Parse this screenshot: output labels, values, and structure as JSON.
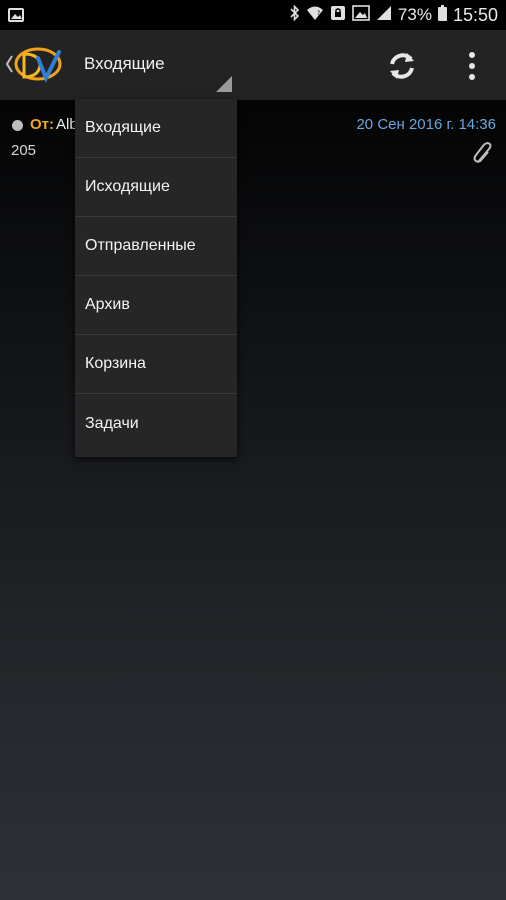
{
  "status_bar": {
    "battery_percent": "73%",
    "time": "15:50",
    "icons": [
      "image-icon",
      "bluetooth-icon",
      "wifi-icon",
      "lock-icon",
      "signal-icon",
      "battery-icon"
    ]
  },
  "app_bar": {
    "logo": "dv-logo",
    "current_folder": "Входящие",
    "actions": [
      "refresh-icon",
      "overflow-menu-icon"
    ]
  },
  "message": {
    "from_label": "От:",
    "from_value": "Alb",
    "date": "20 Сен 2016 г. 14:36",
    "subject": "205",
    "has_attachment": true
  },
  "folder_menu": {
    "items": [
      {
        "label": "Входящие"
      },
      {
        "label": "Исходящие"
      },
      {
        "label": "Отправленные"
      },
      {
        "label": "Архив"
      },
      {
        "label": "Корзина"
      },
      {
        "label": "Задачи"
      }
    ]
  },
  "colors": {
    "from_label": "#f0a820",
    "date": "#6aa6df",
    "appbar": "#232323",
    "menu_bg": "#262626"
  }
}
